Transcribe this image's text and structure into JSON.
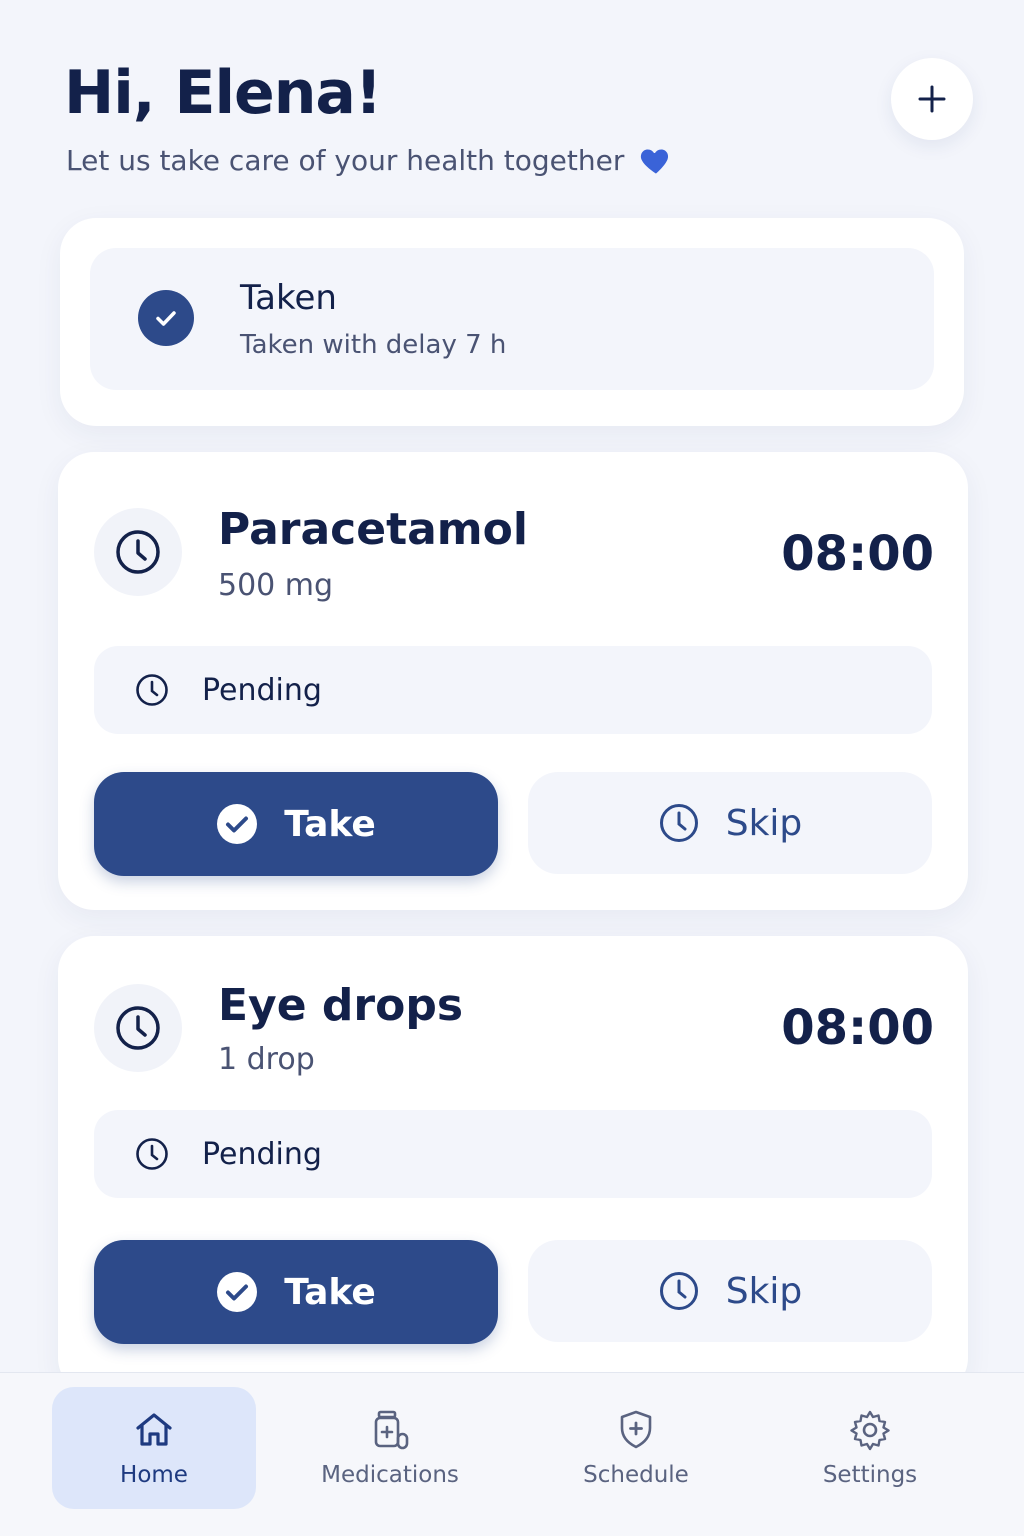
{
  "header": {
    "greeting": "Hi, Elena!",
    "subtitle": "Let us take care of your health together",
    "subtitle_icon": "heart-icon",
    "add_icon": "plus-icon"
  },
  "taken_card": {
    "title": "Taken",
    "subtitle": "Taken with delay 7 h"
  },
  "medications": [
    {
      "name": "Paracetamol",
      "dose": "500 mg",
      "time": "08:00",
      "status": "Pending",
      "take_label": "Take",
      "skip_label": "Skip"
    },
    {
      "name": "Eye drops",
      "dose": "1 drop",
      "time": "08:00",
      "status": "Pending",
      "take_label": "Take",
      "skip_label": "Skip"
    }
  ],
  "nav": {
    "items": [
      {
        "label": "Home",
        "icon": "home-icon",
        "active": true
      },
      {
        "label": "Medications",
        "icon": "medication-bottle-icon",
        "active": false
      },
      {
        "label": "Schedule",
        "icon": "shield-plus-icon",
        "active": false
      },
      {
        "label": "Settings",
        "icon": "gear-icon",
        "active": false
      }
    ]
  },
  "colors": {
    "primary": "#2d4a8a",
    "text": "#13214a",
    "muted": "#4a5373",
    "background": "#f3f5fb",
    "active_nav": "#dde6fa",
    "heart": "#3a63d8"
  }
}
